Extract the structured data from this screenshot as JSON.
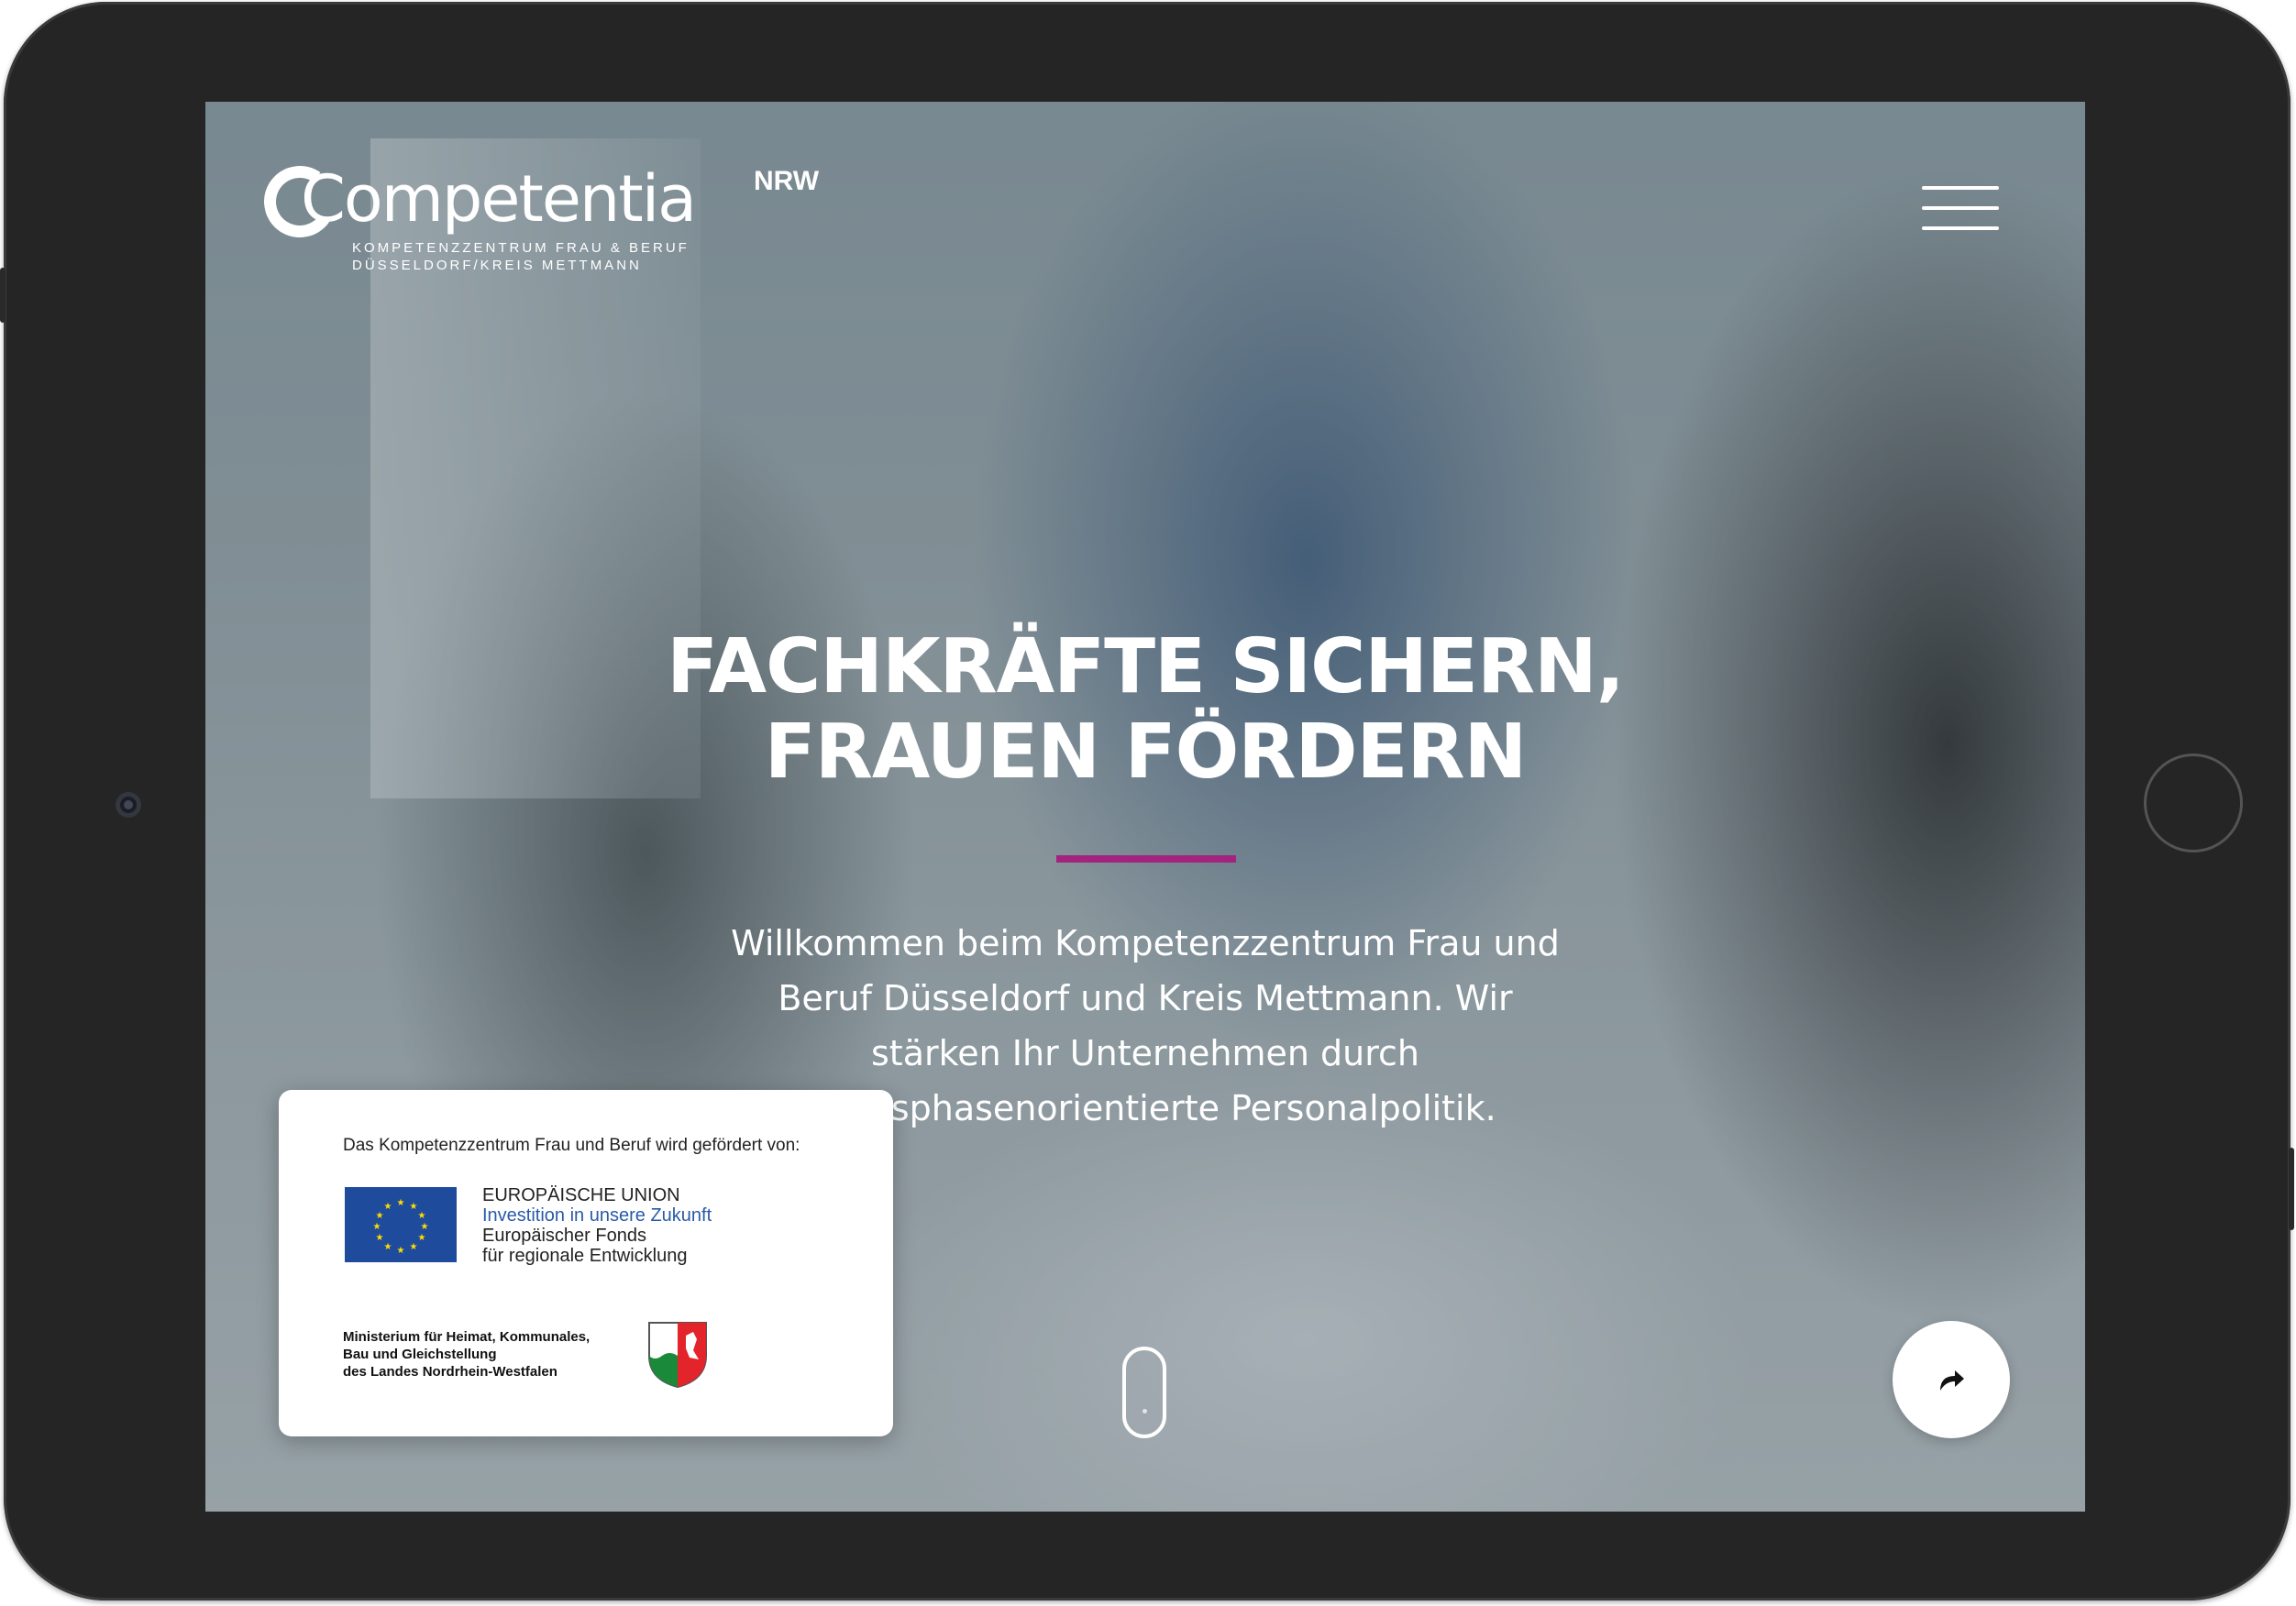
{
  "logo": {
    "wordmark": "Competentia",
    "superscript": "NRW",
    "subline_1": "KOMPETENZZENTRUM FRAU & BERUF",
    "subline_2": "DÜSSELDORF/KREIS METTMANN"
  },
  "nav": {
    "menu_icon": "hamburger-menu-icon"
  },
  "hero": {
    "title_line_1": "FACHKRÄFTE SICHERN,",
    "title_line_2": "FRAUEN FÖRDERN",
    "intro": "Willkommen beim Kompetenzzentrum Frau und Beruf Düsseldorf und Kreis Mettmann. Wir stärken Ihr Unternehmen durch lebensphasenorientierte Personalpolitik.",
    "accent_color": "#a3247e"
  },
  "funding": {
    "title": "Das Kompetenzzentrum Frau und Beruf wird gefördert von:",
    "eu_line_1": "EUROPÄISCHE UNION",
    "eu_line_2": "Investition in unsere Zukunft",
    "eu_line_3": "Europäischer Fonds",
    "eu_line_4": "für regionale Entwicklung",
    "ministry_line_1": "Ministerium für Heimat, Kommunales,",
    "ministry_line_2": "Bau und Gleichstellung",
    "ministry_line_3": "des Landes Nordrhein-Westfalen",
    "eu_flag_icon": "eu-flag-icon",
    "nrw_icon": "nrw-coat-of-arms-icon"
  },
  "controls": {
    "scroll_icon": "scroll-mouse-icon",
    "share_icon": "share-arrow-icon"
  }
}
